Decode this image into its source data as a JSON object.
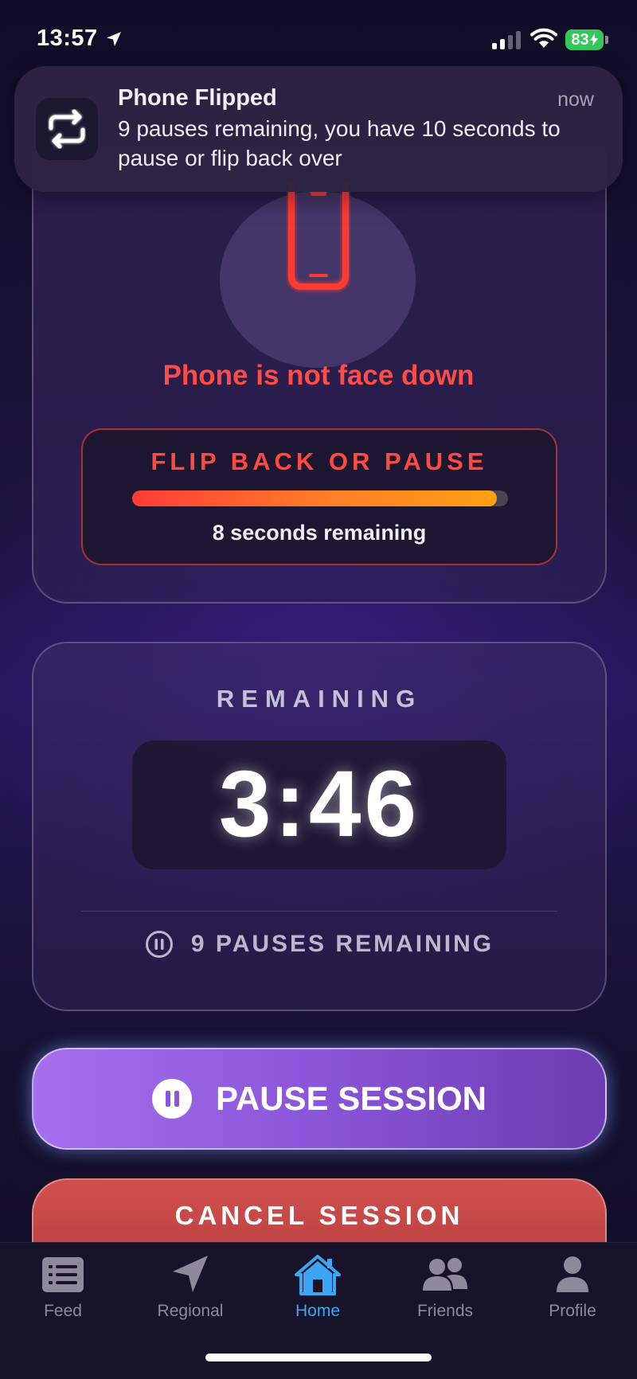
{
  "status_bar": {
    "time": "13:57",
    "battery": "83"
  },
  "notification": {
    "title": "Phone Flipped",
    "time": "now",
    "body": "9 pauses remaining, you have 10 seconds to pause or flip back over",
    "icon": "flip-arrows-icon"
  },
  "orientation_card": {
    "icon": "phone-icon",
    "status_text": "Phone is not face down",
    "warning_title": "FLIP BACK OR PAUSE",
    "countdown_progress": 0.97,
    "countdown_text": "8 seconds remaining",
    "accent_color": "#ff4a3f"
  },
  "timer_card": {
    "label": "REMAINING",
    "time": "3:46",
    "pauses_text": "9 PAUSES REMAINING"
  },
  "actions": {
    "pause_label": "PAUSE SESSION",
    "cancel_label": "CANCEL SESSION"
  },
  "tab_bar": {
    "tabs": [
      {
        "label": "Feed",
        "icon": "feed-icon",
        "active": false
      },
      {
        "label": "Regional",
        "icon": "location-arrow-icon",
        "active": false
      },
      {
        "label": "Home",
        "icon": "home-icon",
        "active": true
      },
      {
        "label": "Friends",
        "icon": "friends-icon",
        "active": false
      },
      {
        "label": "Profile",
        "icon": "profile-icon",
        "active": false
      }
    ],
    "active_color": "#3ea5f4"
  }
}
